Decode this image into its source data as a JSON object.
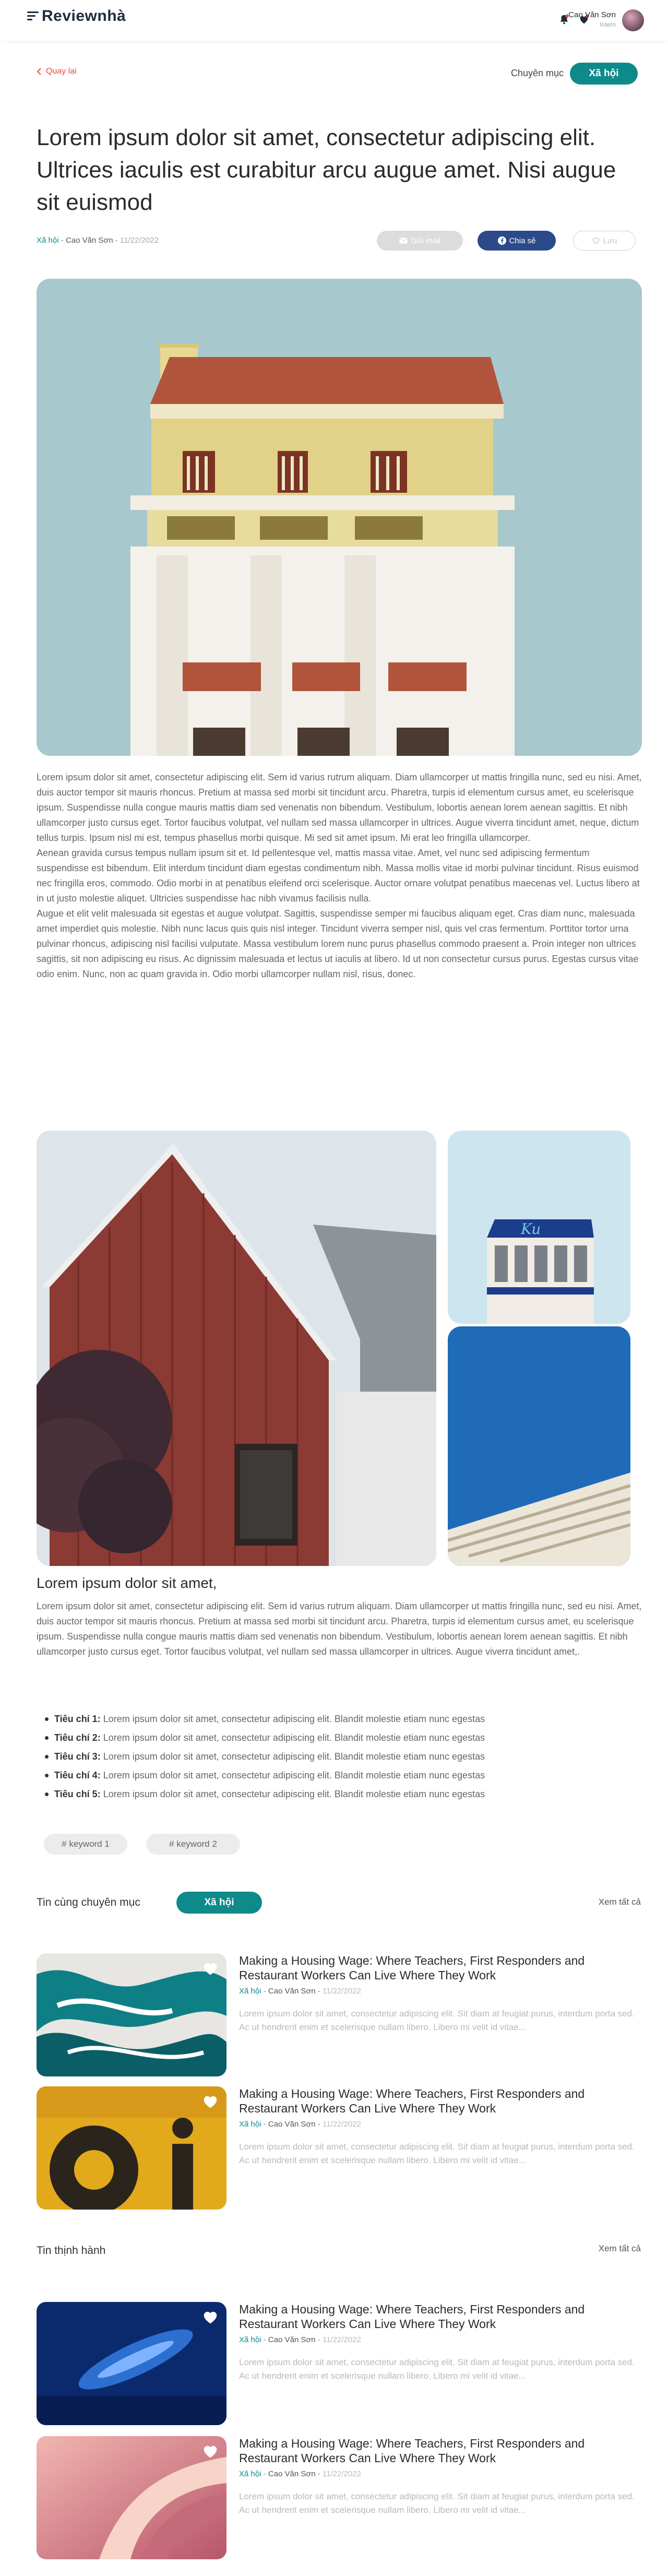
{
  "header": {
    "logo": "Reviewnhà",
    "user_name": "Cao Văn Sơn",
    "user_role": "Intern"
  },
  "nav": {
    "back_label": "Quay lại",
    "category_label": "Chuyên mục",
    "category_value": "Xã hội"
  },
  "article": {
    "title": "Lorem ipsum dolor sit amet, consectetur adipiscing elit. Ultrices iaculis est curabitur arcu augue amet. Nisi augue sit euismod",
    "category": "Xã hội",
    "sep": "-",
    "author": "Cao Văn Sơn",
    "date": "11/22/2022",
    "email_label": "Gửi mail",
    "share_label": "Chia sẻ",
    "save_label": "Lưu",
    "paragraphs": [
      "Lorem ipsum dolor sit amet, consectetur adipiscing elit. Sem id varius rutrum aliquam. Diam ullamcorper ut mattis fringilla nunc, sed eu nisi. Amet, duis auctor tempor sit mauris rhoncus. Pretium at massa sed morbi sit tincidunt arcu. Pharetra, turpis id elementum cursus amet, eu scelerisque ipsum. Suspendisse nulla congue mauris mattis diam sed venenatis non bibendum. Vestibulum, lobortis aenean lorem aenean sagittis. Et nibh ullamcorper justo cursus eget. Tortor faucibus volutpat, vel nullam sed massa ullamcorper in ultrices. Augue viverra tincidunt amet, neque, dictum tellus turpis. Ipsum nisl mi est, tempus phasellus morbi quisque. Mi sed sit amet ipsum. Mi erat leo fringilla ullamcorper.",
      "Aenean gravida cursus tempus nullam ipsum sit et. Id pellentesque vel, mattis massa vitae. Amet, vel nunc sed adipiscing fermentum suspendisse est bibendum. Elit interdum tincidunt diam egestas condimentum nibh. Massa mollis vitae id morbi pulvinar tincidunt. Risus euismod nec fringilla eros, commodo. Odio morbi in at penatibus eleifend orci scelerisque. Auctor ornare volutpat penatibus maecenas vel. Luctus libero at in ut justo molestie aliquet. Ultricies suspendisse hac nibh vivamus facilisis nulla.",
      "Augue et elit velit malesuada sit egestas et augue volutpat. Sagittis, suspendisse semper mi faucibus aliquam eget. Cras diam nunc, malesuada amet imperdiet quis molestie. Nibh nunc lacus quis quis nisl integer. Tincidunt viverra semper nisl, quis vel cras fermentum. Porttitor tortor urna pulvinar rhoncus, adipiscing nisl facilisi vulputate. Massa vestibulum lorem nunc purus phasellus commodo praesent a. Proin integer non ultrices sagittis, sit non adipiscing eu risus. Ac dignissim malesuada et lectus ut iaculis at libero. Id ut non consectetur cursus purus. Egestas cursus vitae odio enim. Nunc, non ac quam gravida in. Odio morbi ullamcorper nullam nisl, risus, donec."
    ],
    "section_heading": "Lorem ipsum dolor sit amet,",
    "section_paragraph": "Lorem ipsum dolor sit amet, consectetur adipiscing elit. Sem id varius rutrum aliquam. Diam ullamcorper ut mattis fringilla nunc, sed eu nisi. Amet, duis auctor tempor sit mauris rhoncus. Pretium at massa sed morbi sit tincidunt arcu. Pharetra, turpis id elementum cursus amet, eu scelerisque ipsum. Suspendisse nulla congue mauris mattis diam sed venenatis non bibendum. Vestibulum, lobortis aenean lorem aenean sagittis. Et nibh ullamcorper justo cursus eget. Tortor faucibus volutpat, vel nullam sed massa ullamcorper in ultrices. Augue viverra tincidunt amet,.",
    "criteria": [
      {
        "label": "Tiêu chí 1:",
        "text": "Lorem ipsum dolor sit amet, consectetur adipiscing elit. Blandit molestie etiam nunc egestas"
      },
      {
        "label": "Tiêu chí 2:",
        "text": "Lorem ipsum dolor sit amet, consectetur adipiscing elit. Blandit molestie etiam nunc egestas"
      },
      {
        "label": "Tiêu chí 3:",
        "text": "Lorem ipsum dolor sit amet, consectetur adipiscing elit. Blandit molestie etiam nunc egestas"
      },
      {
        "label": "Tiêu chí 4:",
        "text": "Lorem ipsum dolor sit amet, consectetur adipiscing elit. Blandit molestie etiam nunc egestas"
      },
      {
        "label": "Tiêu chí 5:",
        "text": "Lorem ipsum dolor sit amet, consectetur adipiscing elit. Blandit molestie etiam nunc egestas"
      }
    ],
    "keywords": [
      "# keyword 1",
      "# keyword 2"
    ]
  },
  "related": {
    "title": "Tin cùng chuyên mục",
    "pill": "Xã hội",
    "see_all": "Xem tất cả"
  },
  "trending": {
    "title": "Tin thịnh hành",
    "see_all": "Xem tất cả"
  },
  "card": {
    "title": "Making a Housing Wage: Where Teachers, First Responders and Restaurant Workers Can Live Where They Work",
    "category": "Xã hội",
    "sep": "-",
    "author": "Cao Văn Sơn",
    "date": "11/22/2022",
    "excerpt": "Lorem ipsum dolor sit amet, consectetur adipiscing elit. Sit diam at feugiat purus, interdum porta sed. Ac ut hendrerit enim et scelerisque nullam libero. Libero mi velit id vitae..."
  },
  "colors": {
    "accent": "#0e8a8a",
    "back_link": "#e74c3c",
    "share_button": "#2c4a8a",
    "email_button": "#dcdcdc"
  }
}
